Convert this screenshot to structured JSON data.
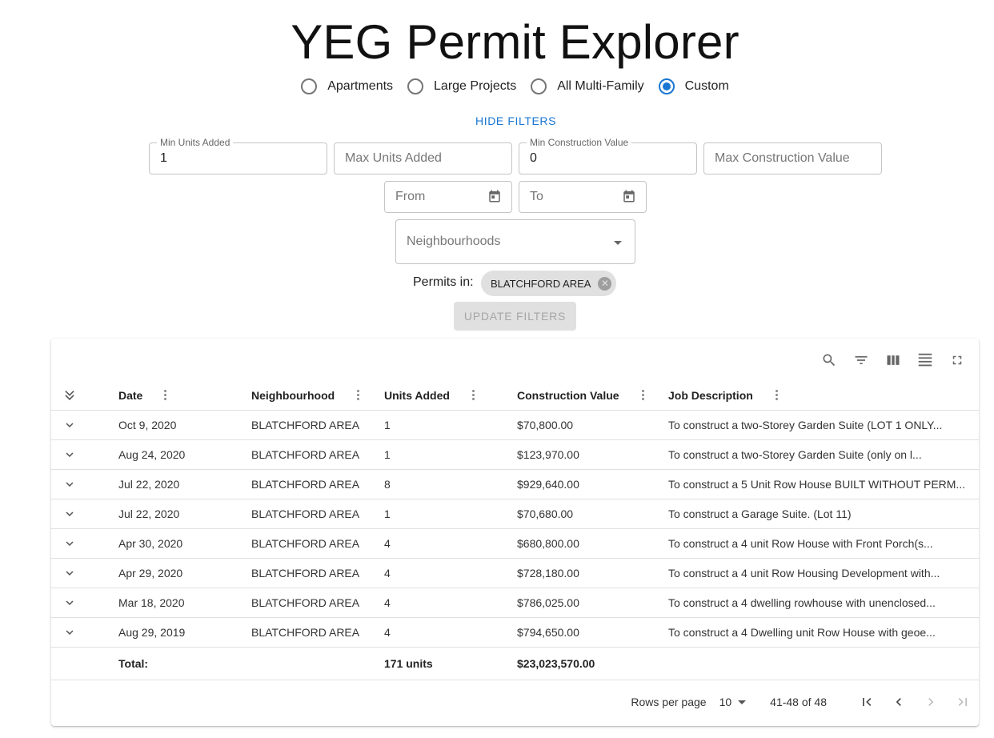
{
  "title": "YEG Permit Explorer",
  "presets": [
    {
      "label": "Apartments",
      "checked": false
    },
    {
      "label": "Large Projects",
      "checked": false
    },
    {
      "label": "All Multi-Family",
      "checked": false
    },
    {
      "label": "Custom",
      "checked": true
    }
  ],
  "hide_filters": "HIDE FILTERS",
  "filters": {
    "min_units": {
      "label": "Min Units Added",
      "value": "1"
    },
    "max_units": {
      "placeholder": "Max Units Added",
      "value": ""
    },
    "min_value": {
      "label": "Min Construction Value",
      "value": "0"
    },
    "max_value": {
      "placeholder": "Max Construction Value",
      "value": ""
    },
    "from": {
      "placeholder": "From"
    },
    "to": {
      "placeholder": "To"
    },
    "neighbourhoods": {
      "placeholder": "Neighbourhoods"
    }
  },
  "permits_in_label": "Permits in:",
  "selected_chip": "BLATCHFORD AREA",
  "update_button": "UPDATE FILTERS",
  "table": {
    "columns": [
      "Date",
      "Neighbourhood",
      "Units Added",
      "Construction Value",
      "Job Description"
    ],
    "rows": [
      [
        "Oct 9, 2020",
        "BLATCHFORD AREA",
        "1",
        "$70,800.00",
        "To construct a two-Storey Garden Suite (LOT 1 ONLY..."
      ],
      [
        "Aug 24, 2020",
        "BLATCHFORD AREA",
        "1",
        "$123,970.00",
        "To construct a two-Storey Garden Suite (only on l..."
      ],
      [
        "Jul 22, 2020",
        "BLATCHFORD AREA",
        "8",
        "$929,640.00",
        "To construct a 5 Unit Row House BUILT WITHOUT PERM..."
      ],
      [
        "Jul 22, 2020",
        "BLATCHFORD AREA",
        "1",
        "$70,680.00",
        "To construct a Garage Suite. (Lot 11)"
      ],
      [
        "Apr 30, 2020",
        "BLATCHFORD AREA",
        "4",
        "$680,800.00",
        "To construct a 4 unit Row House with Front Porch(s..."
      ],
      [
        "Apr 29, 2020",
        "BLATCHFORD AREA",
        "4",
        "$728,180.00",
        "To construct a 4 unit Row Housing Development with..."
      ],
      [
        "Mar 18, 2020",
        "BLATCHFORD AREA",
        "4",
        "$786,025.00",
        "To construct a 4 dwelling rowhouse with unenclosed..."
      ],
      [
        "Aug 29, 2019",
        "BLATCHFORD AREA",
        "4",
        "$794,650.00",
        "To construct a 4 Dwelling unit Row House with geoe..."
      ]
    ],
    "total_label": "Total:",
    "total_units": "171 units",
    "total_value": "$23,023,570.00"
  },
  "pagination": {
    "rows_per_page_label": "Rows per page",
    "rows_per_page": "10",
    "range": "41-48 of 48"
  },
  "colors": {
    "accent": "#1976d2",
    "chip_bg": "#e0e0e0",
    "disabled_bg": "#e0e0e0"
  }
}
